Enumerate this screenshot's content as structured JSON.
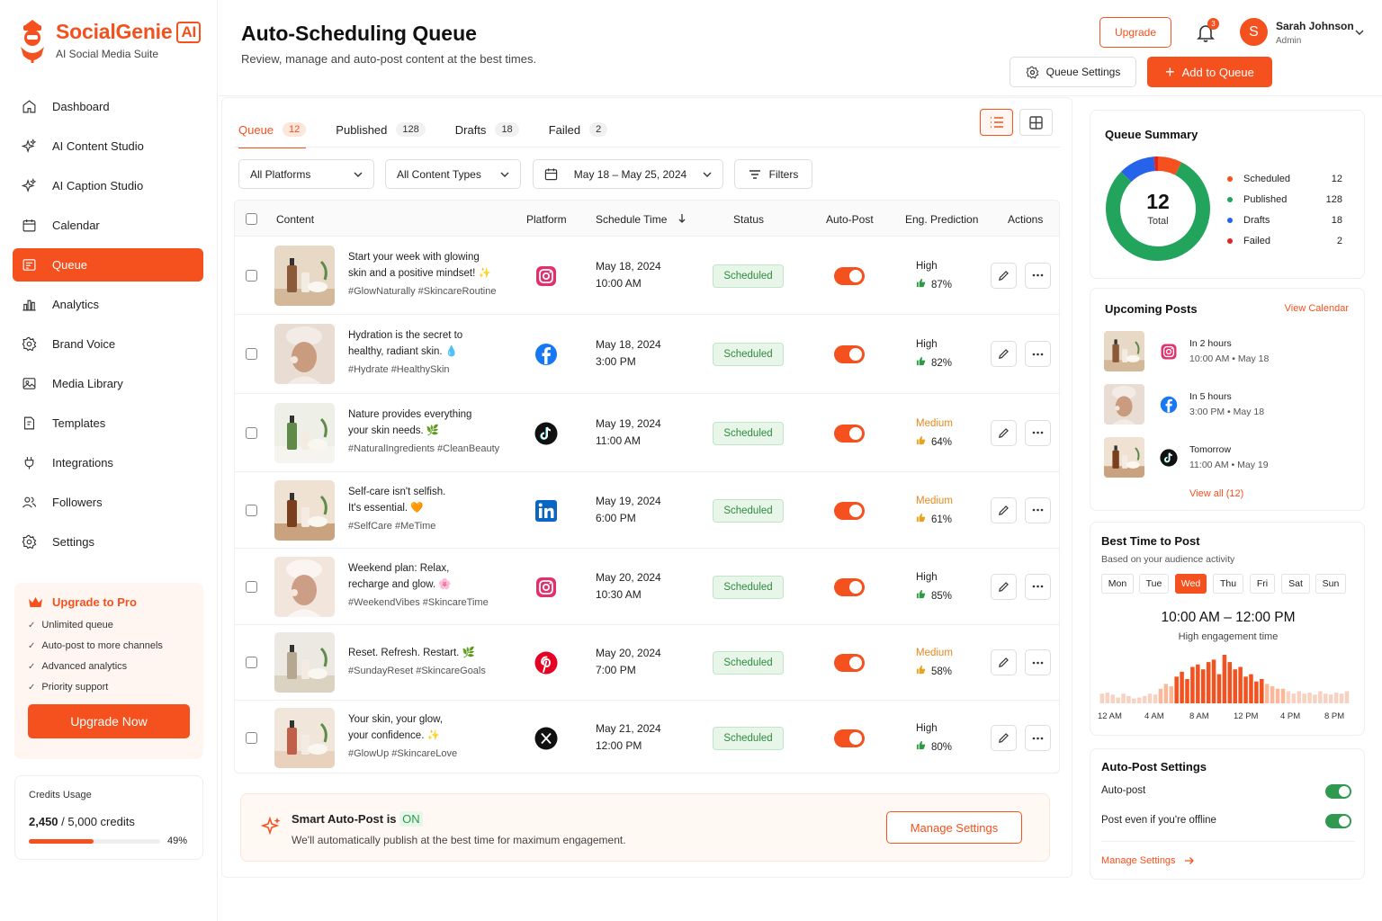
{
  "app": {
    "name": "SocialGenie",
    "badge": "AI",
    "tagline": "AI Social Media Suite"
  },
  "nav": [
    {
      "label": "Dashboard",
      "icon": "home-icon"
    },
    {
      "label": "AI Content Studio",
      "icon": "sparkle-icon"
    },
    {
      "label": "AI Caption Studio",
      "icon": "sparkle-icon"
    },
    {
      "label": "Calendar",
      "icon": "calendar-icon"
    },
    {
      "label": "Queue",
      "icon": "queue-icon",
      "active": true
    },
    {
      "label": "Analytics",
      "icon": "analytics-icon"
    },
    {
      "label": "Brand Voice",
      "icon": "gear-icon"
    },
    {
      "label": "Media Library",
      "icon": "image-icon"
    },
    {
      "label": "Templates",
      "icon": "template-icon"
    },
    {
      "label": "Integrations",
      "icon": "integration-icon"
    },
    {
      "label": "Followers",
      "icon": "users-icon"
    },
    {
      "label": "Settings",
      "icon": "gear-icon"
    }
  ],
  "upgrade": {
    "title": "Upgrade to Pro",
    "features": [
      "Unlimited queue",
      "Auto-post to more channels",
      "Advanced analytics",
      "Priority support"
    ],
    "button": "Upgrade Now"
  },
  "credits": {
    "title": "Credits Usage",
    "used": "2,450",
    "total": "/ 5,000 credits",
    "percent": "49%",
    "fraction": 0.49
  },
  "header": {
    "title": "Auto-Scheduling Queue",
    "subtitle": "Review, manage and auto-post content at the best times.",
    "upgrade": "Upgrade",
    "notifications": "3",
    "user_initial": "S",
    "user_name": "Sarah Johnson",
    "user_role": "Admin",
    "queue_settings": "Queue Settings",
    "add_to_queue": "Add to Queue"
  },
  "tabs": [
    {
      "label": "Queue",
      "count": "12"
    },
    {
      "label": "Published",
      "count": "128"
    },
    {
      "label": "Drafts",
      "count": "18"
    },
    {
      "label": "Failed",
      "count": "2"
    }
  ],
  "filters": {
    "platforms": "All Platforms",
    "types": "All Content Types",
    "dates": "May 18 – May 25, 2024",
    "filters": "Filters"
  },
  "columns": [
    "Content",
    "Platform",
    "Schedule Time",
    "Status",
    "Auto-Post",
    "Eng. Prediction",
    "Actions"
  ],
  "rows": [
    {
      "line1": "Start your week with glowing",
      "line2": "skin and a positive mindset! ✨",
      "tags": "#GlowNaturally #SkincareRoutine",
      "platform": "instagram-icon",
      "date": "May 18, 2024",
      "time": "10:00 AM",
      "status": "Scheduled",
      "level": "High",
      "pct": "87%"
    },
    {
      "line1": "Hydration is the secret to",
      "line2": "healthy, radiant skin. 💧",
      "tags": "#Hydrate #HealthySkin",
      "platform": "facebook-icon",
      "date": "May 18, 2024",
      "time": "3:00 PM",
      "status": "Scheduled",
      "level": "High",
      "pct": "82%"
    },
    {
      "line1": "Nature provides everything",
      "line2": "your skin needs. 🌿",
      "tags": "#NaturalIngredients #CleanBeauty",
      "platform": "tiktok-icon",
      "date": "May 19, 2024",
      "time": "11:00 AM",
      "status": "Scheduled",
      "level": "Medium",
      "pct": "64%"
    },
    {
      "line1": "Self-care isn't selfish.",
      "line2": "It's essential. 🧡",
      "tags": "#SelfCare #MeTime",
      "platform": "linkedin-icon",
      "date": "May 19, 2024",
      "time": "6:00 PM",
      "status": "Scheduled",
      "level": "Medium",
      "pct": "61%"
    },
    {
      "line1": "Weekend plan: Relax,",
      "line2": "recharge and glow. 🌸",
      "tags": "#WeekendVibes #SkincareTime",
      "platform": "instagram-icon",
      "date": "May 20, 2024",
      "time": "10:30 AM",
      "status": "Scheduled",
      "level": "High",
      "pct": "85%"
    },
    {
      "line1": "Reset. Refresh. Restart. 🌿",
      "line2": "",
      "tags": "#SundayReset #SkincareGoals",
      "platform": "pinterest-icon",
      "date": "May 20, 2024",
      "time": "7:00 PM",
      "status": "Scheduled",
      "level": "Medium",
      "pct": "58%"
    },
    {
      "line1": "Your skin, your glow,",
      "line2": "your confidence. ✨",
      "tags": "#GlowUp #SkincareLove",
      "platform": "x-icon",
      "date": "May 21, 2024",
      "time": "12:00 PM",
      "status": "Scheduled",
      "level": "High",
      "pct": "80%"
    }
  ],
  "smart": {
    "title": "Smart Auto-Post is",
    "state": "ON",
    "subtitle": "We'll automatically publish at the best time for maximum engagement.",
    "button": "Manage Settings"
  },
  "summary": {
    "title": "Queue Summary",
    "total": "12",
    "total_label": "Total",
    "items": [
      {
        "label": "Scheduled",
        "value": 12,
        "color": "#f4511e"
      },
      {
        "label": "Published",
        "value": 128,
        "color": "#22a45d"
      },
      {
        "label": "Drafts",
        "value": 18,
        "color": "#2563eb"
      },
      {
        "label": "Failed",
        "value": 2,
        "color": "#e02424"
      }
    ]
  },
  "upcoming": {
    "title": "Upcoming Posts",
    "link": "View Calendar",
    "items": [
      {
        "when": "In 2 hours",
        "time": "10:00 AM",
        "date": "May 18",
        "platform": "instagram-icon"
      },
      {
        "when": "In 5 hours",
        "time": "3:00 PM",
        "date": "May 18",
        "platform": "facebook-icon"
      },
      {
        "when": "Tomorrow",
        "time": "11:00 AM",
        "date": "May 19",
        "platform": "tiktok-icon"
      }
    ],
    "view_all": "View all (12)"
  },
  "best_time": {
    "title": "Best Time to Post",
    "subtitle": "Based on your audience activity",
    "days": [
      "Mon",
      "Tue",
      "Wed",
      "Thu",
      "Fri",
      "Sat",
      "Sun"
    ],
    "active_day": "Wed",
    "range": "10:00 AM – 12:00 PM",
    "caption": "High engagement time",
    "hour_labels": [
      "12 AM",
      "4 AM",
      "8 AM",
      "12 PM",
      "4 PM",
      "8 PM"
    ],
    "activity": [
      0.2,
      0.22,
      0.18,
      0.12,
      0.2,
      0.15,
      0.1,
      0.12,
      0.15,
      0.2,
      0.18,
      0.3,
      0.4,
      0.35,
      0.55,
      0.65,
      0.5,
      0.75,
      0.8,
      0.7,
      0.85,
      0.9,
      0.6,
      1.0,
      0.85,
      0.7,
      0.75,
      0.55,
      0.6,
      0.45,
      0.5,
      0.4,
      0.35,
      0.3,
      0.3,
      0.25,
      0.2,
      0.25,
      0.2,
      0.22,
      0.18,
      0.25,
      0.2,
      0.18,
      0.22,
      0.2,
      0.25
    ]
  },
  "autopost": {
    "title": "Auto-Post Settings",
    "options": [
      {
        "label": "Auto-post",
        "on": true
      },
      {
        "label": "Post even if you're offline",
        "on": true
      }
    ],
    "link": "Manage Settings"
  },
  "colors": {
    "accent": "#f4511e",
    "success": "#22a45d",
    "medium": "#e58a1c"
  }
}
